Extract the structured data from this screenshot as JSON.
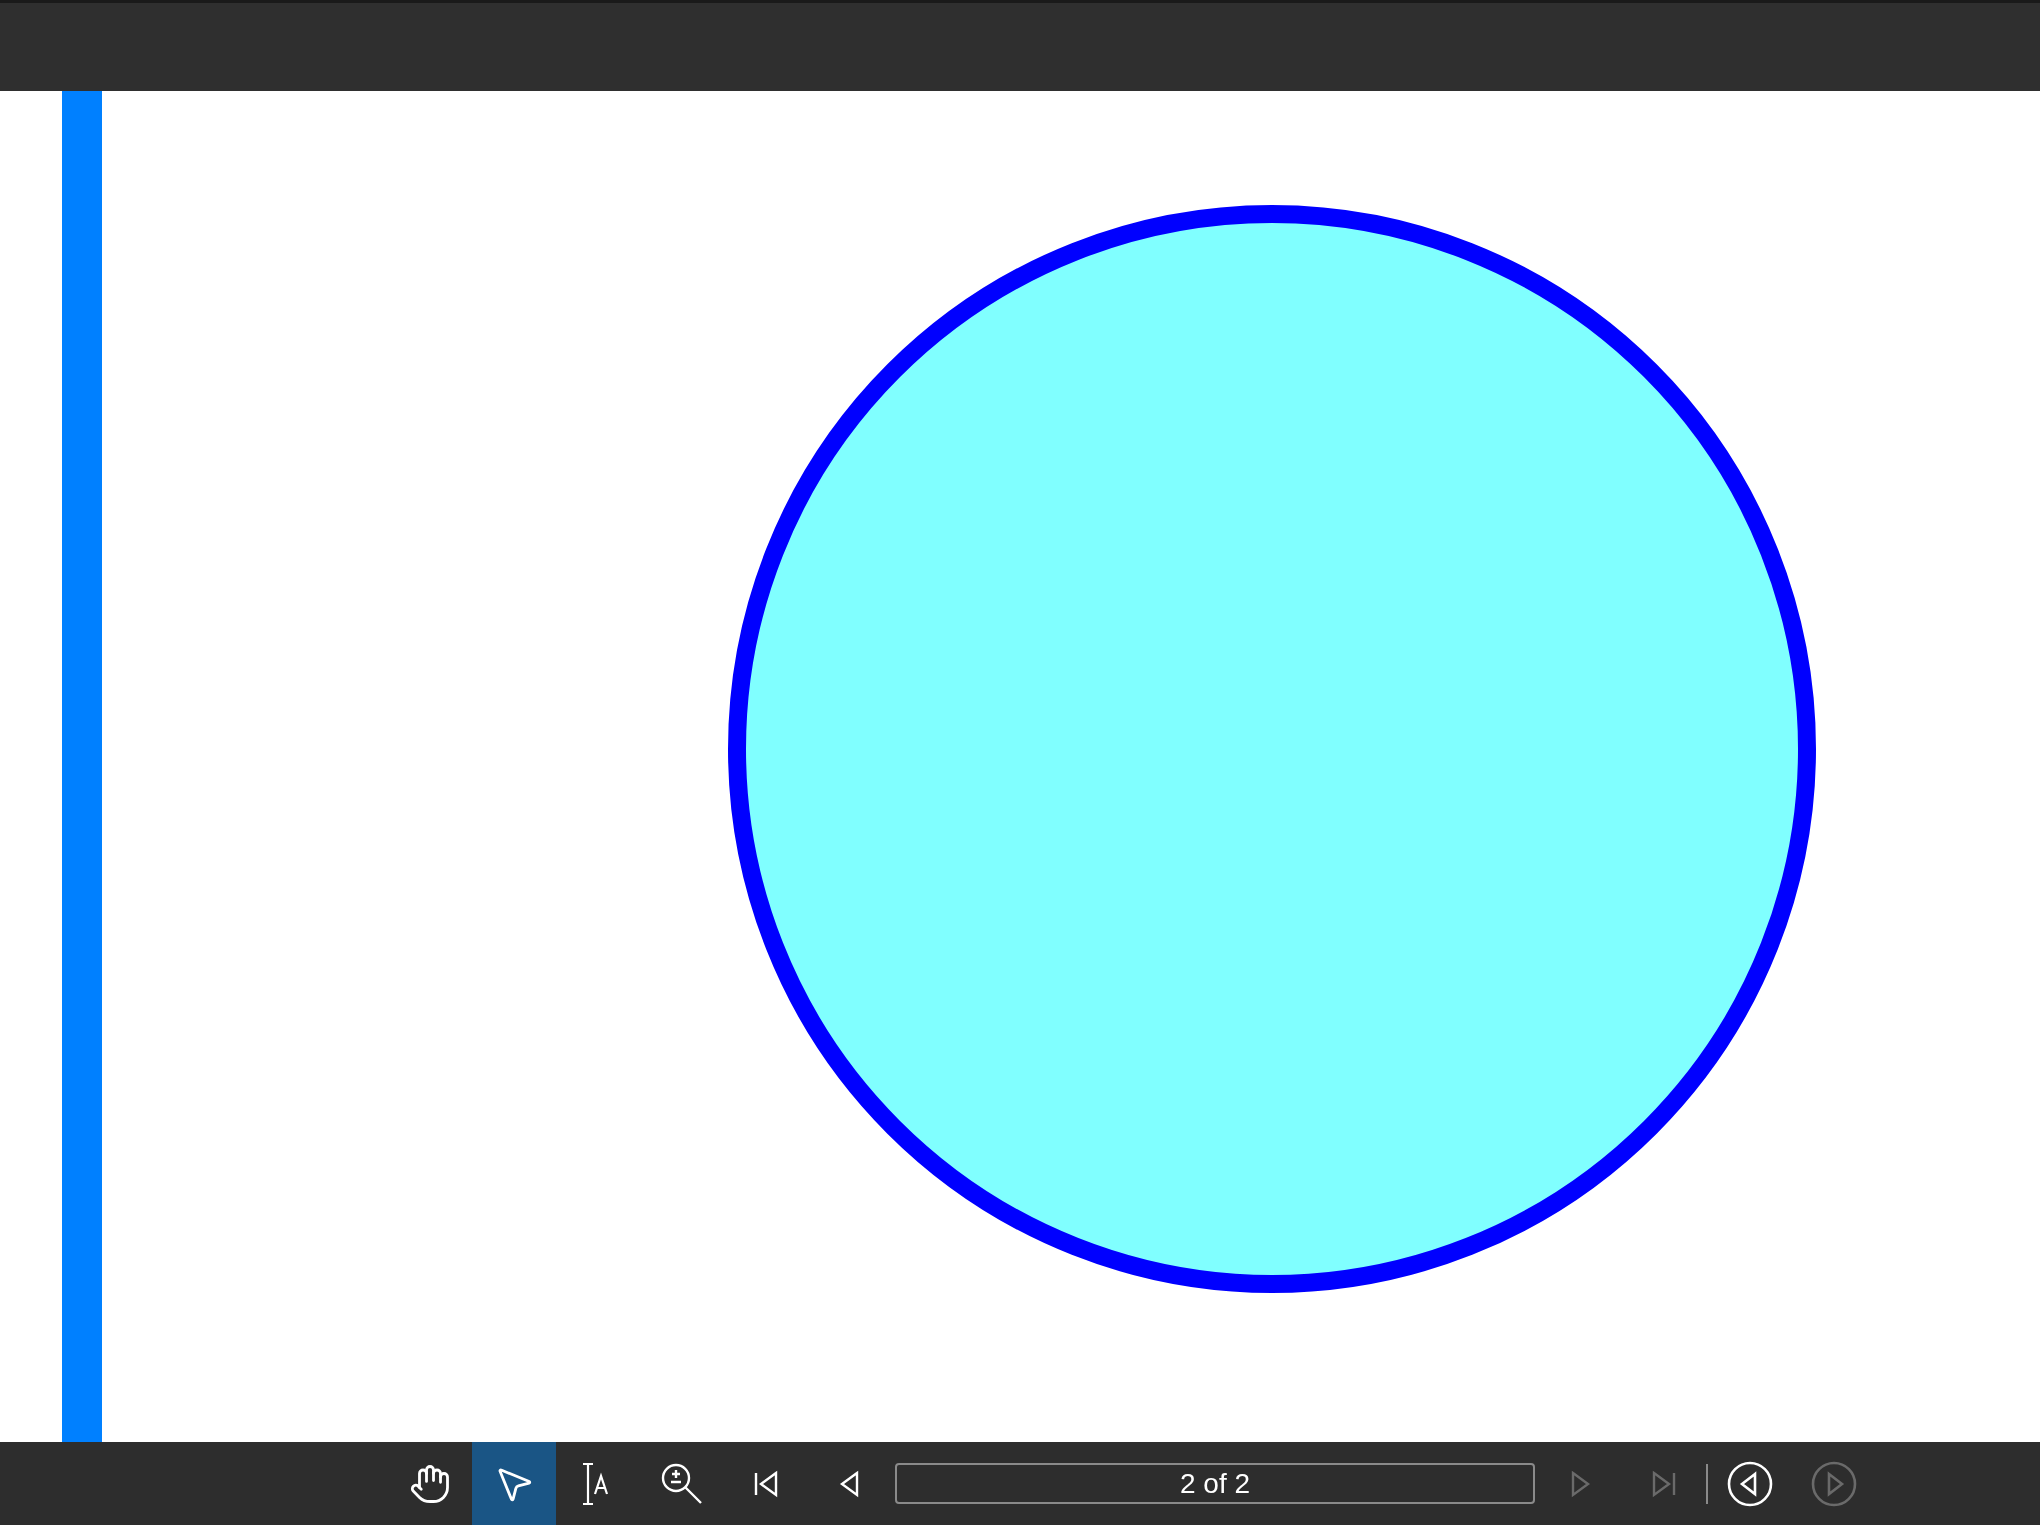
{
  "tools": [
    {
      "kind": "hand",
      "selected": false
    },
    {
      "kind": "select",
      "selected": true
    },
    {
      "kind": "text",
      "selected": false
    },
    {
      "kind": "zoom",
      "selected": false
    }
  ],
  "nav_before": [
    {
      "kind": "first",
      "disabled": false
    },
    {
      "kind": "prev",
      "disabled": false
    }
  ],
  "page_field": {
    "value": "2 of 2"
  },
  "nav_after": [
    {
      "kind": "next",
      "disabled": true
    },
    {
      "kind": "last",
      "disabled": true
    }
  ],
  "history": [
    {
      "kind": "back",
      "disabled": false
    },
    {
      "kind": "forward",
      "disabled": true
    }
  ]
}
